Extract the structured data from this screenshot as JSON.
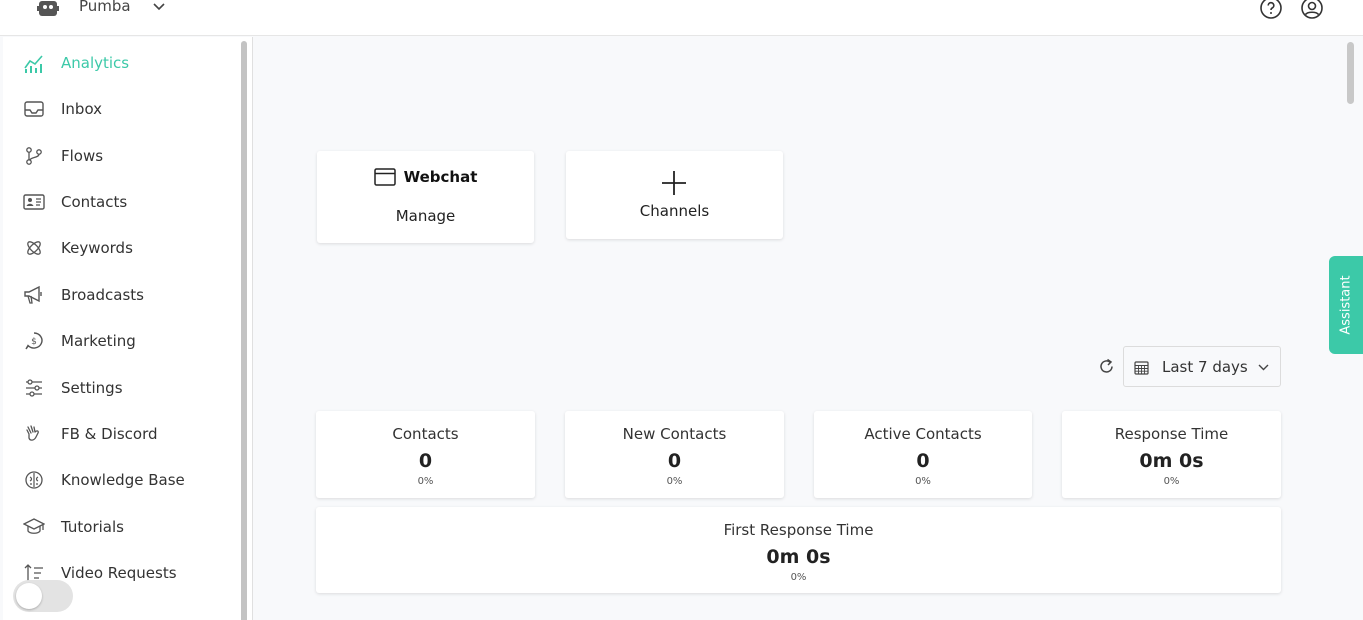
{
  "topbar": {
    "bot_name": "Pumba",
    "icons": {
      "bot": "robot-icon",
      "help": "help-circle-icon",
      "user": "user-circle-icon"
    }
  },
  "sidebar": {
    "items": [
      {
        "label": "Analytics",
        "icon": "analytics-icon",
        "active": true
      },
      {
        "label": "Inbox",
        "icon": "inbox-icon"
      },
      {
        "label": "Flows",
        "icon": "flows-icon"
      },
      {
        "label": "Contacts",
        "icon": "contacts-icon"
      },
      {
        "label": "Keywords",
        "icon": "keywords-icon"
      },
      {
        "label": "Broadcasts",
        "icon": "megaphone-icon"
      },
      {
        "label": "Marketing",
        "icon": "marketing-icon"
      },
      {
        "label": "Settings",
        "icon": "sliders-icon"
      },
      {
        "label": "FB & Discord",
        "icon": "wave-hand-icon"
      },
      {
        "label": "Knowledge Base",
        "icon": "brain-icon"
      },
      {
        "label": "Tutorials",
        "icon": "graduation-cap-icon"
      },
      {
        "label": "Video Requests",
        "icon": "sort-icon"
      }
    ]
  },
  "channels": {
    "webchat_title": "Webchat",
    "webchat_action": "Manage",
    "add_label": "Channels"
  },
  "filter": {
    "range": "Last 7 days"
  },
  "stats": [
    {
      "title": "Contacts",
      "value": "0",
      "change": "0%"
    },
    {
      "title": "New Contacts",
      "value": "0",
      "change": "0%"
    },
    {
      "title": "Active Contacts",
      "value": "0",
      "change": "0%"
    },
    {
      "title": "Response Time",
      "value": "0m 0s",
      "change": "0%"
    },
    {
      "title": "First Response Time",
      "value": "0m 0s",
      "change": "0%"
    }
  ],
  "assistant": {
    "label": "Assistant"
  },
  "colors": {
    "accent": "#3cc9a8"
  }
}
